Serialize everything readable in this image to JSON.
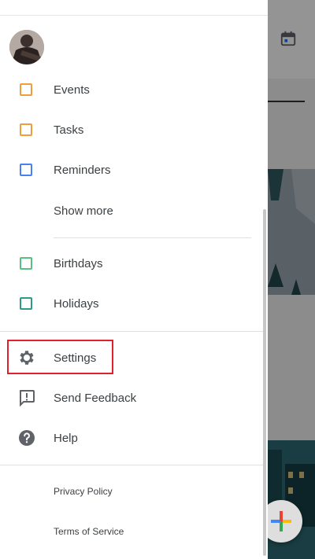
{
  "drawer": {
    "calendars": [
      {
        "label": "Events",
        "color": "#f09e3c"
      },
      {
        "label": "Tasks",
        "color": "#f09e3c"
      },
      {
        "label": "Reminders",
        "color": "#4a80f0"
      }
    ],
    "show_more_label": "Show more",
    "other_calendars": [
      {
        "label": "Birthdays",
        "color": "#5bbf7d"
      },
      {
        "label": "Holidays",
        "color": "#2f9a87"
      }
    ],
    "menu": {
      "settings_label": "Settings",
      "feedback_label": "Send Feedback",
      "help_label": "Help"
    },
    "footer": {
      "privacy_label": "Privacy Policy",
      "terms_label": "Terms of Service"
    }
  },
  "icons": {
    "settings": "gear-icon",
    "feedback": "feedback-icon",
    "help": "help-icon",
    "calendar": "calendar-icon",
    "fab": "plus-icon"
  },
  "colors": {
    "highlight": "#e0202c",
    "text": "#3c4043"
  }
}
